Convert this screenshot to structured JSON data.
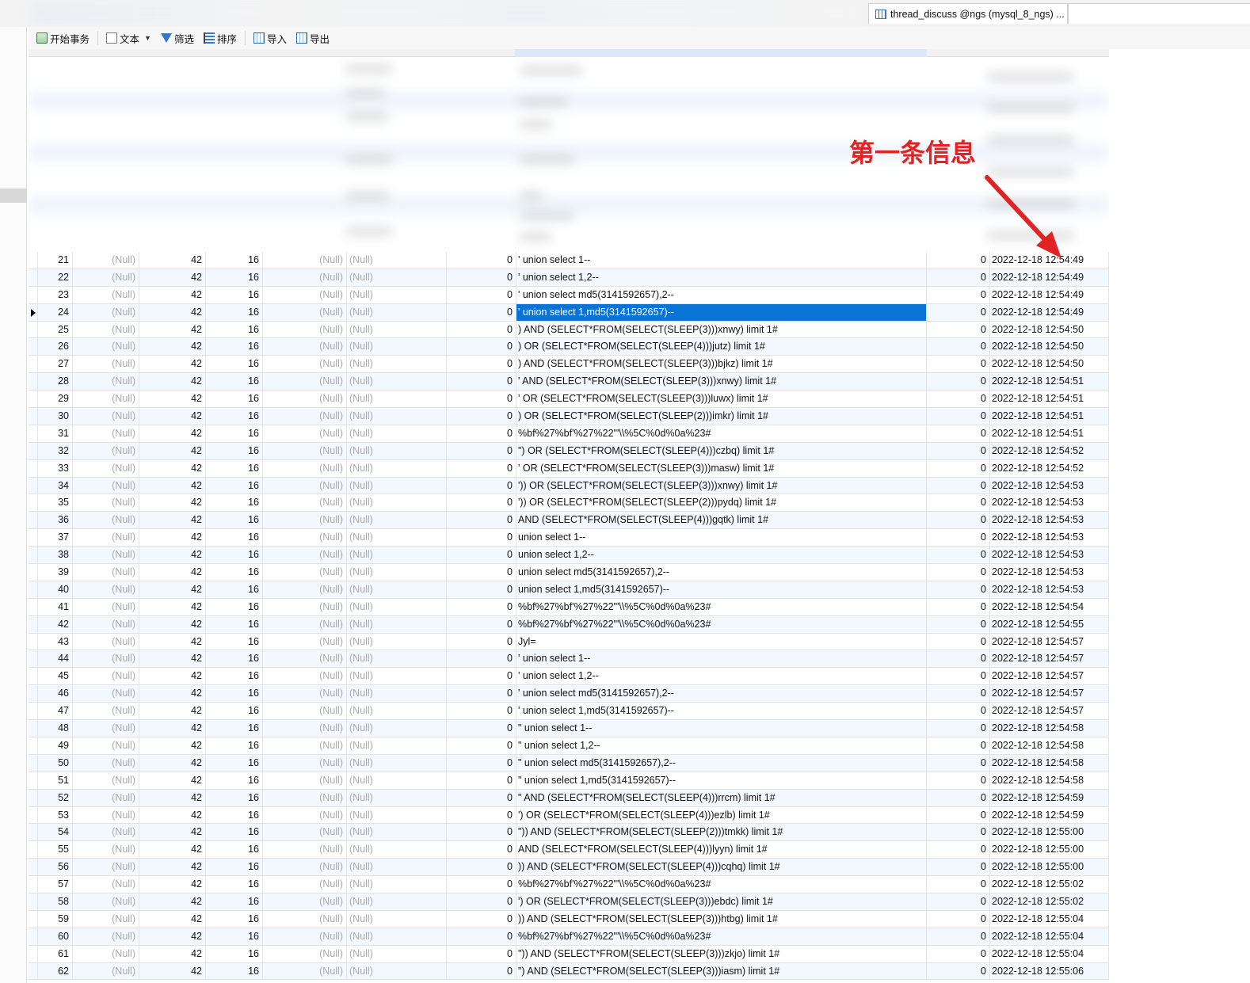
{
  "window": {
    "tab_title": "thread_discuss @ngs (mysql_8_ngs) ..."
  },
  "toolbar": {
    "begin_transaction": "开始事务",
    "text": "文本",
    "filter": "筛选",
    "sort": "排序",
    "import": "导入",
    "export": "导出"
  },
  "annotation": {
    "label": "第一条信息",
    "color": "#e02424"
  },
  "colors": {
    "selection": "#0a74d6",
    "null_text": "#aaaaaa",
    "alt_row": "#f3f8fe"
  },
  "null_label": "(Null)",
  "rows": [
    {
      "id": "21",
      "a": "42",
      "b": "16",
      "c": "0",
      "text": "' union select 1--",
      "d": "0",
      "time": "2022-12-18 12:54:49"
    },
    {
      "id": "22",
      "a": "42",
      "b": "16",
      "c": "0",
      "text": "' union select 1,2--",
      "d": "0",
      "time": "2022-12-18 12:54:49"
    },
    {
      "id": "23",
      "a": "42",
      "b": "16",
      "c": "0",
      "text": "' union select md5(3141592657),2--",
      "d": "0",
      "time": "2022-12-18 12:54:49"
    },
    {
      "id": "24",
      "a": "42",
      "b": "16",
      "c": "0",
      "text": "' union select 1,md5(3141592657)--",
      "d": "0",
      "time": "2022-12-18 12:54:49",
      "selected": true
    },
    {
      "id": "25",
      "a": "42",
      "b": "16",
      "c": "0",
      "text": ") AND (SELECT*FROM(SELECT(SLEEP(3)))xnwy) limit 1#",
      "d": "0",
      "time": "2022-12-18 12:54:50"
    },
    {
      "id": "26",
      "a": "42",
      "b": "16",
      "c": "0",
      "text": ") OR (SELECT*FROM(SELECT(SLEEP(4)))jutz) limit 1#",
      "d": "0",
      "time": "2022-12-18 12:54:50"
    },
    {
      "id": "27",
      "a": "42",
      "b": "16",
      "c": "0",
      "text": ") AND (SELECT*FROM(SELECT(SLEEP(3)))bjkz) limit 1#",
      "d": "0",
      "time": "2022-12-18 12:54:50"
    },
    {
      "id": "28",
      "a": "42",
      "b": "16",
      "c": "0",
      "text": "' AND (SELECT*FROM(SELECT(SLEEP(3)))xnwy) limit 1#",
      "d": "0",
      "time": "2022-12-18 12:54:51"
    },
    {
      "id": "29",
      "a": "42",
      "b": "16",
      "c": "0",
      "text": "' OR (SELECT*FROM(SELECT(SLEEP(3)))luwx) limit 1#",
      "d": "0",
      "time": "2022-12-18 12:54:51"
    },
    {
      "id": "30",
      "a": "42",
      "b": "16",
      "c": "0",
      "text": ") OR (SELECT*FROM(SELECT(SLEEP(2)))imkr) limit 1#",
      "d": "0",
      "time": "2022-12-18 12:54:51"
    },
    {
      "id": "31",
      "a": "42",
      "b": "16",
      "c": "0",
      "text": "%bf%27%bf'%27%22'\"\\\\%5C%0d%0a%23#",
      "d": "0",
      "time": "2022-12-18 12:54:51"
    },
    {
      "id": "32",
      "a": "42",
      "b": "16",
      "c": "0",
      "text": "\") OR (SELECT*FROM(SELECT(SLEEP(4)))czbq) limit 1#",
      "d": "0",
      "time": "2022-12-18 12:54:52"
    },
    {
      "id": "33",
      "a": "42",
      "b": "16",
      "c": "0",
      "text": "' OR (SELECT*FROM(SELECT(SLEEP(3)))masw) limit 1#",
      "d": "0",
      "time": "2022-12-18 12:54:52"
    },
    {
      "id": "34",
      "a": "42",
      "b": "16",
      "c": "0",
      "text": "')) OR (SELECT*FROM(SELECT(SLEEP(3)))xnwy) limit 1#",
      "d": "0",
      "time": "2022-12-18 12:54:53"
    },
    {
      "id": "35",
      "a": "42",
      "b": "16",
      "c": "0",
      "text": "')) OR (SELECT*FROM(SELECT(SLEEP(2)))pydq) limit 1#",
      "d": "0",
      "time": "2022-12-18 12:54:53"
    },
    {
      "id": "36",
      "a": "42",
      "b": "16",
      "c": "0",
      "text": " AND (SELECT*FROM(SELECT(SLEEP(4)))gqtk) limit 1#",
      "d": "0",
      "time": "2022-12-18 12:54:53"
    },
    {
      "id": "37",
      "a": "42",
      "b": "16",
      "c": "0",
      "text": " union select 1--",
      "d": "0",
      "time": "2022-12-18 12:54:53"
    },
    {
      "id": "38",
      "a": "42",
      "b": "16",
      "c": "0",
      "text": " union select 1,2--",
      "d": "0",
      "time": "2022-12-18 12:54:53"
    },
    {
      "id": "39",
      "a": "42",
      "b": "16",
      "c": "0",
      "text": " union select md5(3141592657),2--",
      "d": "0",
      "time": "2022-12-18 12:54:53"
    },
    {
      "id": "40",
      "a": "42",
      "b": "16",
      "c": "0",
      "text": " union select 1,md5(3141592657)--",
      "d": "0",
      "time": "2022-12-18 12:54:53"
    },
    {
      "id": "41",
      "a": "42",
      "b": "16",
      "c": "0",
      "text": "%bf%27%bf'%27%22'\"\\\\%5C%0d%0a%23#",
      "d": "0",
      "time": "2022-12-18 12:54:54"
    },
    {
      "id": "42",
      "a": "42",
      "b": "16",
      "c": "0",
      "text": "%bf%27%bf'%27%22'\"\\\\%5C%0d%0a%23#",
      "d": "0",
      "time": "2022-12-18 12:54:55"
    },
    {
      "id": "43",
      "a": "42",
      "b": "16",
      "c": "0",
      "text": "Jyl=",
      "d": "0",
      "time": "2022-12-18 12:54:57"
    },
    {
      "id": "44",
      "a": "42",
      "b": "16",
      "c": "0",
      "text": "' union select 1--",
      "d": "0",
      "time": "2022-12-18 12:54:57"
    },
    {
      "id": "45",
      "a": "42",
      "b": "16",
      "c": "0",
      "text": "' union select 1,2--",
      "d": "0",
      "time": "2022-12-18 12:54:57"
    },
    {
      "id": "46",
      "a": "42",
      "b": "16",
      "c": "0",
      "text": "' union select md5(3141592657),2--",
      "d": "0",
      "time": "2022-12-18 12:54:57"
    },
    {
      "id": "47",
      "a": "42",
      "b": "16",
      "c": "0",
      "text": "' union select 1,md5(3141592657)--",
      "d": "0",
      "time": "2022-12-18 12:54:57"
    },
    {
      "id": "48",
      "a": "42",
      "b": "16",
      "c": "0",
      "text": "\" union select 1--",
      "d": "0",
      "time": "2022-12-18 12:54:58"
    },
    {
      "id": "49",
      "a": "42",
      "b": "16",
      "c": "0",
      "text": "\" union select 1,2--",
      "d": "0",
      "time": "2022-12-18 12:54:58"
    },
    {
      "id": "50",
      "a": "42",
      "b": "16",
      "c": "0",
      "text": "\" union select md5(3141592657),2--",
      "d": "0",
      "time": "2022-12-18 12:54:58"
    },
    {
      "id": "51",
      "a": "42",
      "b": "16",
      "c": "0",
      "text": "\" union select 1,md5(3141592657)--",
      "d": "0",
      "time": "2022-12-18 12:54:58"
    },
    {
      "id": "52",
      "a": "42",
      "b": "16",
      "c": "0",
      "text": "\" AND (SELECT*FROM(SELECT(SLEEP(4)))rrcm) limit 1#",
      "d": "0",
      "time": "2022-12-18 12:54:59"
    },
    {
      "id": "53",
      "a": "42",
      "b": "16",
      "c": "0",
      "text": "') OR (SELECT*FROM(SELECT(SLEEP(4)))ezlb) limit 1#",
      "d": "0",
      "time": "2022-12-18 12:54:59"
    },
    {
      "id": "54",
      "a": "42",
      "b": "16",
      "c": "0",
      "text": "\")) AND (SELECT*FROM(SELECT(SLEEP(2)))tmkk) limit 1#",
      "d": "0",
      "time": "2022-12-18 12:55:00"
    },
    {
      "id": "55",
      "a": "42",
      "b": "16",
      "c": "0",
      "text": " AND (SELECT*FROM(SELECT(SLEEP(4)))lyyn) limit 1#",
      "d": "0",
      "time": "2022-12-18 12:55:00"
    },
    {
      "id": "56",
      "a": "42",
      "b": "16",
      "c": "0",
      "text": ")) AND (SELECT*FROM(SELECT(SLEEP(4)))cqhq) limit 1#",
      "d": "0",
      "time": "2022-12-18 12:55:00"
    },
    {
      "id": "57",
      "a": "42",
      "b": "16",
      "c": "0",
      "text": "%bf%27%bf'%27%22'\"\\\\%5C%0d%0a%23#",
      "d": "0",
      "time": "2022-12-18 12:55:02"
    },
    {
      "id": "58",
      "a": "42",
      "b": "16",
      "c": "0",
      "text": "') OR (SELECT*FROM(SELECT(SLEEP(3)))ebdc) limit 1#",
      "d": "0",
      "time": "2022-12-18 12:55:02"
    },
    {
      "id": "59",
      "a": "42",
      "b": "16",
      "c": "0",
      "text": ")) AND (SELECT*FROM(SELECT(SLEEP(3)))htbg) limit 1#",
      "d": "0",
      "time": "2022-12-18 12:55:04"
    },
    {
      "id": "60",
      "a": "42",
      "b": "16",
      "c": "0",
      "text": "%bf%27%bf'%27%22'\"\\\\%5C%0d%0a%23#",
      "d": "0",
      "time": "2022-12-18 12:55:04"
    },
    {
      "id": "61",
      "a": "42",
      "b": "16",
      "c": "0",
      "text": "\")) AND (SELECT*FROM(SELECT(SLEEP(3)))zkjo) limit 1#",
      "d": "0",
      "time": "2022-12-18 12:55:04"
    },
    {
      "id": "62",
      "a": "42",
      "b": "16",
      "c": "0",
      "text": "\") AND (SELECT*FROM(SELECT(SLEEP(3)))iasm) limit 1#",
      "d": "0",
      "time": "2022-12-18 12:55:06"
    }
  ]
}
